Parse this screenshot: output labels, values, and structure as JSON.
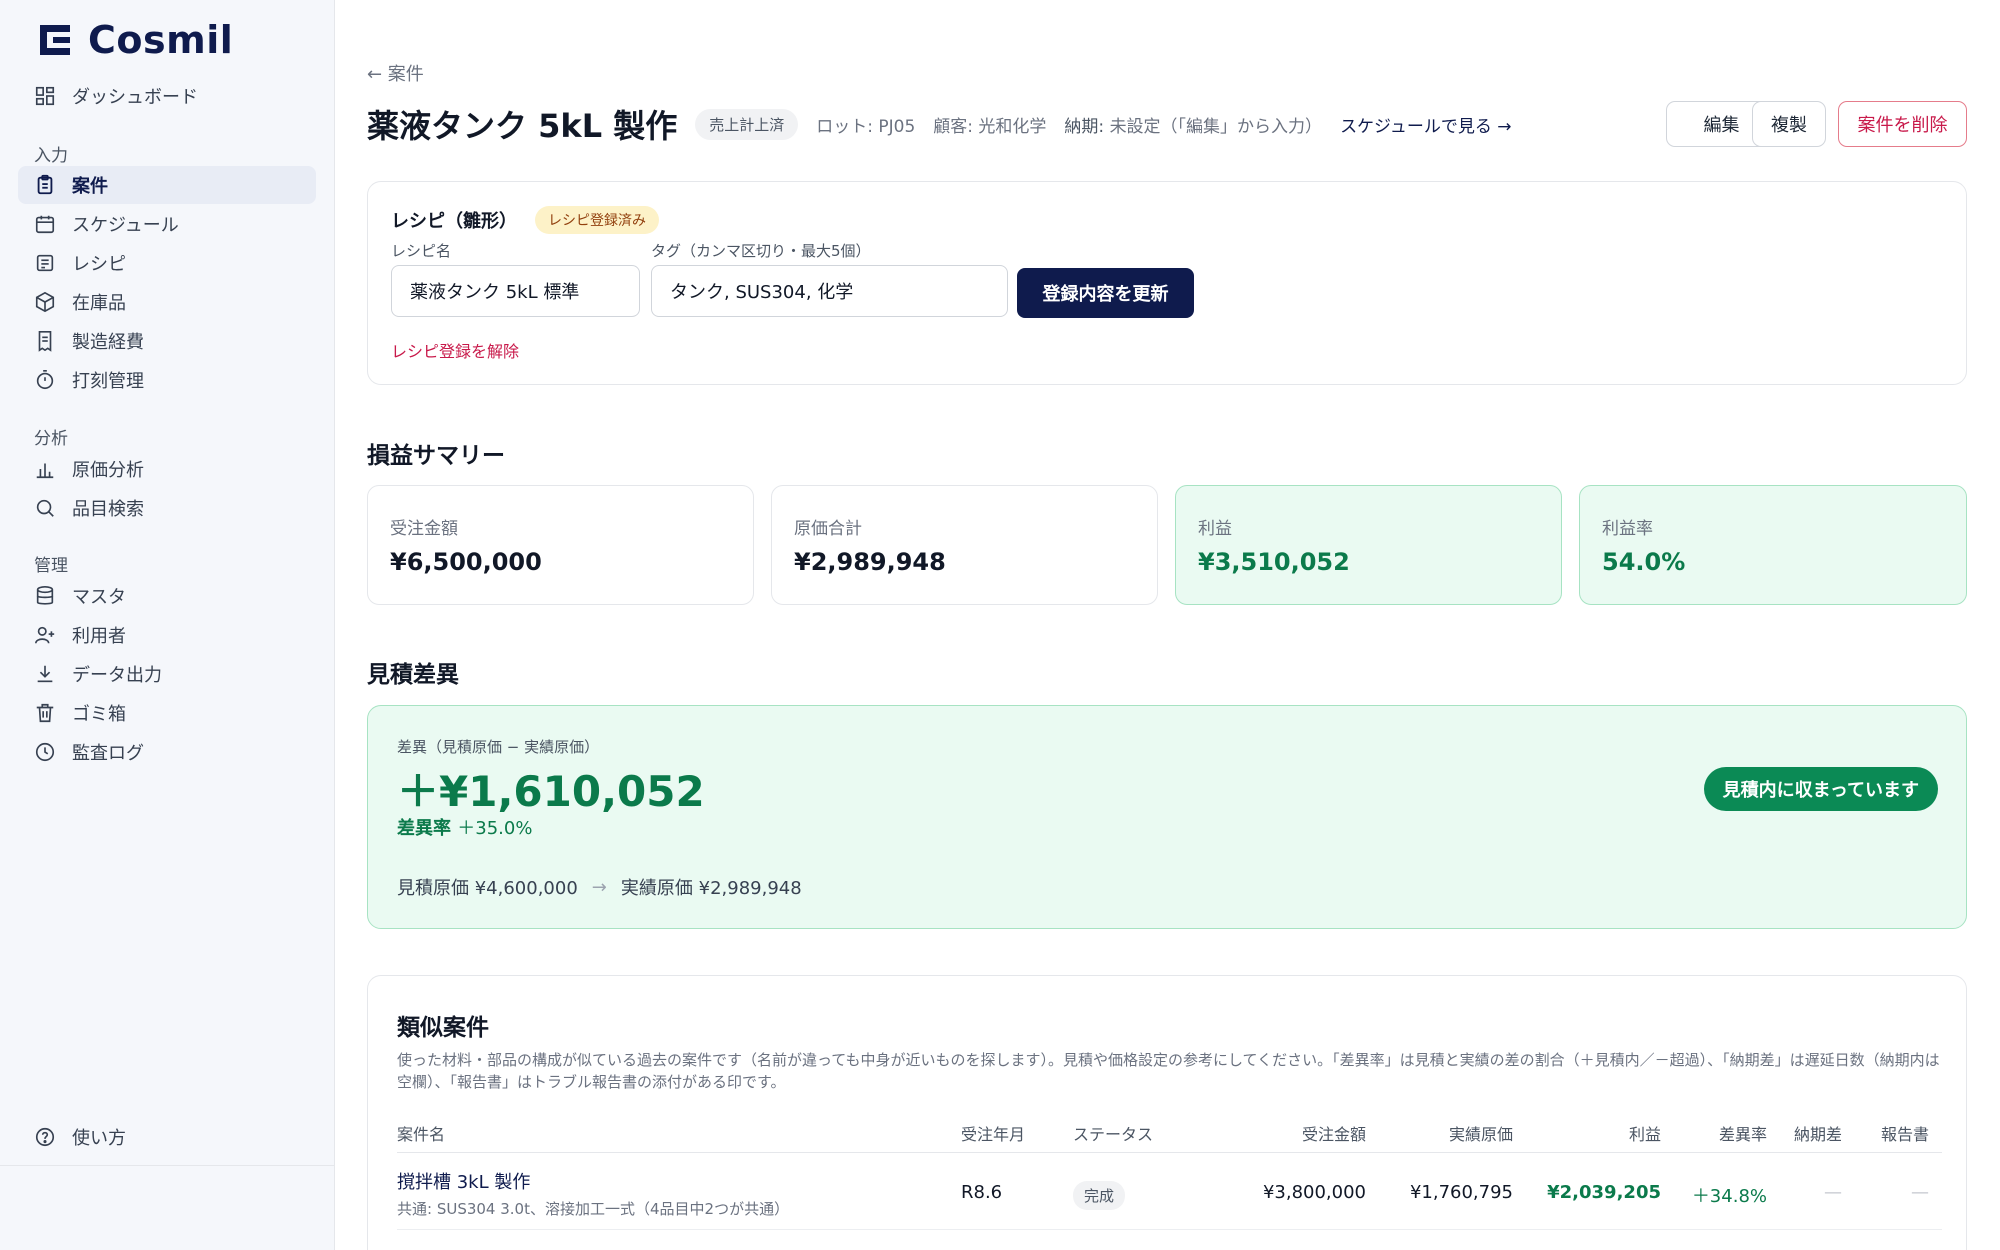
{
  "app": {
    "name": "Cosmil"
  },
  "sidebar": {
    "top_item": {
      "label": "ダッシュボード",
      "icon": "dashboard-icon"
    },
    "sections": [
      {
        "title": "入力",
        "items": [
          {
            "label": "案件",
            "icon": "clipboard-icon",
            "active": true
          },
          {
            "label": "スケジュール",
            "icon": "calendar-icon"
          },
          {
            "label": "レシピ",
            "icon": "recipe-icon"
          },
          {
            "label": "在庫品",
            "icon": "box-icon"
          },
          {
            "label": "製造経費",
            "icon": "receipt-icon"
          },
          {
            "label": "打刻管理",
            "icon": "timer-icon"
          }
        ]
      },
      {
        "title": "分析",
        "items": [
          {
            "label": "原価分析",
            "icon": "bar-chart-icon"
          },
          {
            "label": "品目検索",
            "icon": "search-icon"
          }
        ]
      },
      {
        "title": "管理",
        "items": [
          {
            "label": "マスタ",
            "icon": "database-icon"
          },
          {
            "label": "利用者",
            "icon": "user-plus-icon"
          },
          {
            "label": "データ出力",
            "icon": "download-icon"
          },
          {
            "label": "ゴミ箱",
            "icon": "trash-icon"
          },
          {
            "label": "監査ログ",
            "icon": "clock-icon"
          }
        ]
      }
    ],
    "help": {
      "label": "使い方",
      "icon": "help-icon"
    }
  },
  "header": {
    "back": "← 案件",
    "title": "薬液タンク 5kL 製作",
    "status_badge": "売上計上済",
    "lot": "ロット: PJ05",
    "customer": "顧客: 光和化学",
    "deadline_label": "納期:",
    "deadline_value": "未設定（「編集」から入力）",
    "schedule_link": "スケジュールで見る →",
    "buttons": {
      "edit": "編集",
      "duplicate": "複製",
      "delete": "案件を削除"
    }
  },
  "recipe": {
    "title": "レシピ（雛形）",
    "badge": "レシピ登録済み",
    "name_label": "レシピ名",
    "name_value": "薬液タンク 5kL 標準",
    "tags_label": "タグ（カンマ区切り・最大5個）",
    "tags_value": "タンク, SUS304, 化学",
    "update_button": "登録内容を更新",
    "unregister_link": "レシピ登録を解除"
  },
  "pl_summary": {
    "title": "損益サマリー",
    "cards": [
      {
        "label": "受注金額",
        "value": "¥6,500,000",
        "highlight": false
      },
      {
        "label": "原価合計",
        "value": "¥2,989,948",
        "highlight": false
      },
      {
        "label": "利益",
        "value": "¥3,510,052",
        "highlight": true
      },
      {
        "label": "利益率",
        "value": "54.0%",
        "highlight": true
      }
    ]
  },
  "variance": {
    "title": "見積差異",
    "label": "差異（見積原価 − 実績原価）",
    "value": "＋¥1,610,052",
    "rate_label": "差異率",
    "rate_value": "＋35.0%",
    "estimate": "見積原価 ¥4,600,000",
    "arrow": "→",
    "actual": "実績原価 ¥2,989,948",
    "status_pill": "見積内に収まっています"
  },
  "similar": {
    "title": "類似案件",
    "description": "使った材料・部品の構成が似ている過去の案件です（名前が違っても中身が近いものを探します）。見積や価格設定の参考にしてください。「差異率」は見積と実績の差の割合（＋見積内／－超過）、「納期差」は遅延日数（納期内は空欄）、「報告書」はトラブル報告書の添付がある印です。",
    "columns": {
      "name": "案件名",
      "month": "受注年月",
      "status": "ステータス",
      "amount": "受注金額",
      "actual": "実績原価",
      "profit": "利益",
      "rate": "差異率",
      "delay": "納期差",
      "report": "報告書"
    },
    "rows": [
      {
        "name": "撹拌槽 3kL 製作",
        "sub": "共通: SUS304 3.0t、溶接加工一式（4品目中2つが共通）",
        "month": "R8.6",
        "status": "完成",
        "amount": "¥3,800,000",
        "actual": "¥1,760,795",
        "profit": "¥2,039,205",
        "rate": "＋34.8%",
        "delay": "—",
        "report": "—"
      }
    ]
  },
  "colors": {
    "brand": "#0f1b4d",
    "success": "#0b7a4b",
    "danger": "#c8194a",
    "warning_bg": "#fdf2c8"
  }
}
